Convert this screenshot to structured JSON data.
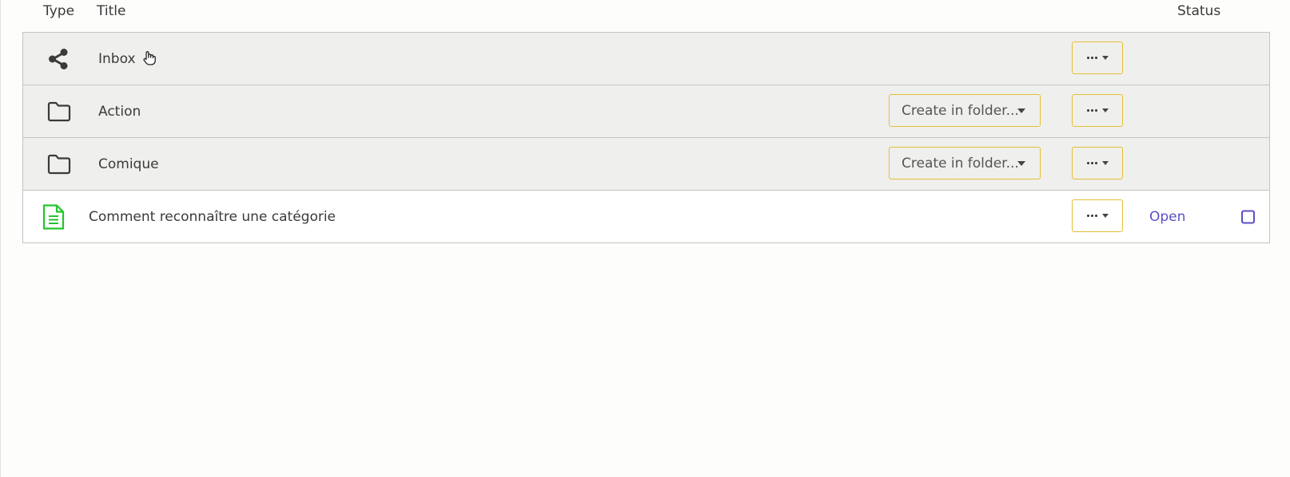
{
  "header": {
    "type_label": "Type",
    "title_label": "Title",
    "status_label": "Status"
  },
  "rows": [
    {
      "kind": "shared-folder",
      "icon": "share-icon",
      "title": "Inbox",
      "more_label": "⋯",
      "status": ""
    },
    {
      "kind": "folder",
      "icon": "folder-icon",
      "title": "Action",
      "create_label": "Create in folder...",
      "more_label": "⋯",
      "status": ""
    },
    {
      "kind": "folder",
      "icon": "folder-icon",
      "title": "Comique",
      "create_label": "Create in folder...",
      "more_label": "⋯",
      "status": ""
    },
    {
      "kind": "document",
      "icon": "document-icon",
      "title": "Comment reconnaître une catégorie",
      "more_label": "⋯",
      "status": "Open",
      "checked": false
    }
  ],
  "colors": {
    "folder_row_bg": "#efefed",
    "button_border": "#e3c034",
    "link": "#5a4fc8",
    "document_icon": "#22c52a"
  }
}
